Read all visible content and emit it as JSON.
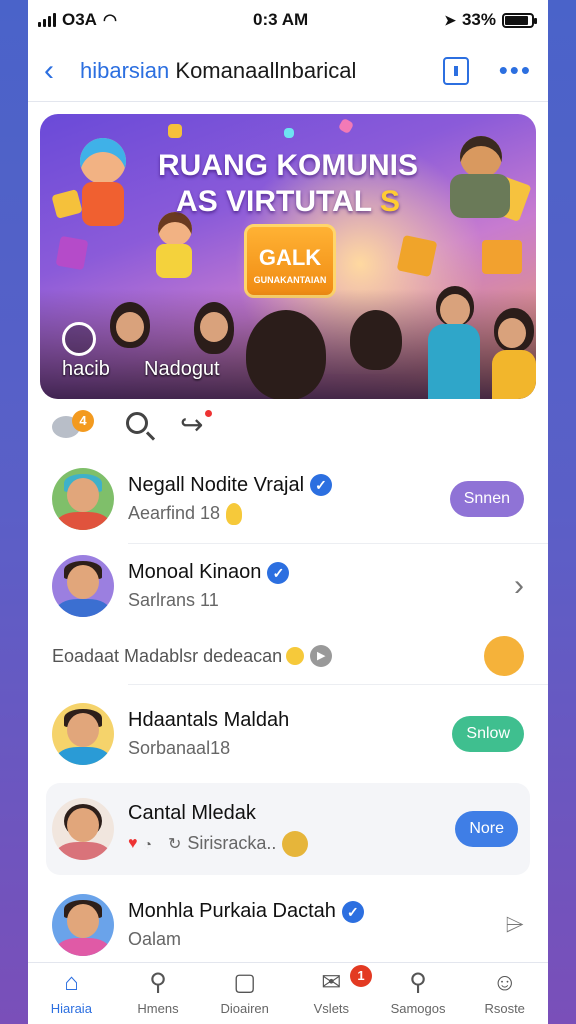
{
  "status": {
    "carrier": "O3A",
    "time": "0:3 AM",
    "battery": "33%"
  },
  "nav": {
    "title_prefix": "hibarsian",
    "title_rest": " Komanaallnbarical"
  },
  "banner": {
    "headline_line1": "RUANG KOMUNIS",
    "headline_line2": "AS VIRTUTAL",
    "headline_accent": "S",
    "cta_main": "GALK",
    "cta_sub": "GUNAKANTAIAN",
    "tag_left": "hacib",
    "tag_right": "Nadogut"
  },
  "actions": {
    "comment_count": "4"
  },
  "contacts": [
    {
      "name": "Negall Nodite Vrajal",
      "sub": "Aearfind 18",
      "verified": true,
      "action": "Snnen",
      "action_color": "#8f73d6",
      "avatar_bg": "#7fbf6a",
      "shirt": "#e0533d"
    },
    {
      "name": "Monoal Kinaon",
      "sub": "Sarlrans 11",
      "verified": true,
      "avatar_bg": "#9b7fe0",
      "shirt": "#3b6fd1"
    },
    {
      "name": "Hdaantals Maldah",
      "sub": "Sorbanaal18",
      "verified": false,
      "action": "Snlow",
      "action_color": "#3fbf8f",
      "avatar_bg": "#f5d36b",
      "shirt": "#2a9bd6"
    },
    {
      "name": "Cantal Mledak",
      "sub": "Sirisracka..",
      "verified": false,
      "action": "Nore",
      "action_color": "#3f7ee6",
      "avatar_bg": "#f1e6de",
      "shirt": "#d9737a"
    },
    {
      "name": "Monhla Purkaia Dactah",
      "sub": "Oalam",
      "verified": true,
      "avatar_bg": "#6aa3ea",
      "shirt": "#e05aa6"
    }
  ],
  "message_line": "Eoadaat Madablsr dedeacan",
  "tabs": [
    {
      "label": "Hiaraia",
      "icon": "home-icon"
    },
    {
      "label": "Hmens",
      "icon": "search-icon"
    },
    {
      "label": "Dioairen",
      "icon": "document-icon"
    },
    {
      "label": "Vslets",
      "icon": "mail-icon",
      "badge": "1"
    },
    {
      "label": "Samogos",
      "icon": "location-icon"
    },
    {
      "label": "Rsoste",
      "icon": "profile-icon"
    }
  ]
}
